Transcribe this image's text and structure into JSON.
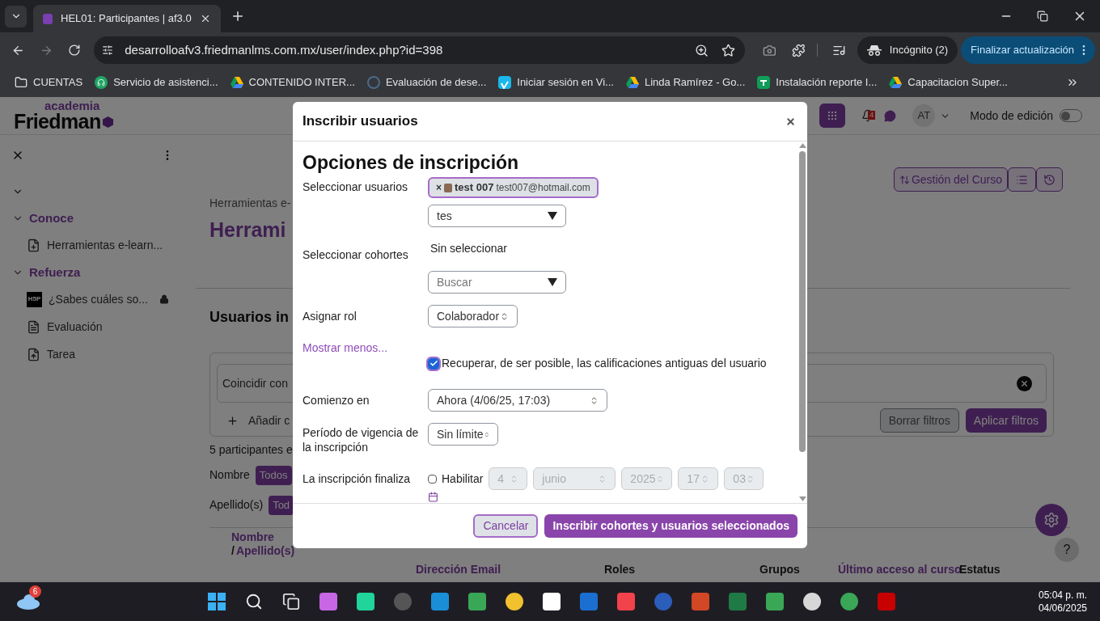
{
  "browser": {
    "tabs": [
      {
        "title": "HEL01: Participantes | af3.0",
        "selected": true
      }
    ],
    "url": "desarrolloafv3.friedmanlms.com.mx/user/index.php?id=398",
    "bookmarks": [
      {
        "label": "CUENTAS",
        "kind": "folder"
      },
      {
        "label": "Servicio de asistenci...",
        "kind": "headset"
      },
      {
        "label": "CONTENIDO INTER...",
        "kind": "drive"
      },
      {
        "label": "Evaluación de dese...",
        "kind": "af"
      },
      {
        "label": "Iniciar sesión en Vi...",
        "kind": "vimeo"
      },
      {
        "label": "Linda Ramírez - Go...",
        "kind": "drive"
      },
      {
        "label": "Instalación reporte I...",
        "kind": "sheet"
      },
      {
        "label": "Capacitacion Super...",
        "kind": "drive"
      }
    ],
    "incognito": "Incógnito (2)",
    "update_button": "Finalizar actualización"
  },
  "site": {
    "logo_top": "academia",
    "logo_main": "Friedman",
    "notifications": "4",
    "avatar": "AT",
    "edit_mode": {
      "label": "Modo de edición",
      "on": false
    }
  },
  "drawer": {
    "sections": [
      {
        "title": "Conoce",
        "expanded": true,
        "items": [
          {
            "label": "Herramientas e-learn...",
            "kind": "page",
            "locked": false
          }
        ]
      },
      {
        "title": "Refuerza",
        "expanded": true,
        "items": [
          {
            "label": "¿Sabes cuáles so...",
            "kind": "h5p",
            "logo_text": "H5P",
            "locked": true
          },
          {
            "label": "Evaluación",
            "kind": "quiz",
            "locked": false
          },
          {
            "label": "Tarea",
            "kind": "assign",
            "locked": false
          }
        ]
      }
    ]
  },
  "page": {
    "breadcrumb": "Herramientas e-",
    "title": "Herrami",
    "course_menu": "Gestión del Curso",
    "section_title": "Usuarios in",
    "filter": {
      "match_label": "Coincidir con",
      "add_label": "Añadir c",
      "clear": "Borrar filtros",
      "apply": "Aplicar filtros"
    },
    "count": "5 participantes e",
    "initials": [
      {
        "label": "Nombre",
        "button": "Todos"
      },
      {
        "label": "Apellido(s)",
        "button": "Tod"
      }
    ],
    "table": {
      "name_header": "Nombre",
      "name_separator": "/",
      "surname_header": "Apellido(s)",
      "columns": [
        {
          "label": "Dirección Email",
          "sortable": true
        },
        {
          "label": "Roles",
          "sortable": false
        },
        {
          "label": "Grupos",
          "sortable": false
        },
        {
          "label": "Último acceso al curso",
          "sortable": true
        },
        {
          "label": "Estatus",
          "sortable": false
        }
      ]
    },
    "help": "?"
  },
  "modal": {
    "title": "Inscribir usuarios",
    "heading": "Opciones de inscripción",
    "users": {
      "label": "Seleccionar usuarios",
      "chip": {
        "remove": "×",
        "name": "test 007",
        "email": "test007@hotmail.com"
      },
      "search_value": "tes"
    },
    "cohorts": {
      "label": "Seleccionar cohortes",
      "status": "Sin seleccionar",
      "placeholder": "Buscar"
    },
    "role": {
      "label": "Asignar rol",
      "value": "Colaborador"
    },
    "toggle_link": "Mostrar menos...",
    "recover": {
      "label": "Recuperar, de ser posible, las calificaciones antiguas del usuario",
      "checked": true
    },
    "start": {
      "label": "Comienzo en",
      "value": "Ahora (4/06/25, 17:03)"
    },
    "duration": {
      "label": "Período de vigencia de la inscripción",
      "value": "Sin límite"
    },
    "end": {
      "label": "La inscripción finaliza",
      "enable_label": "Habilitar",
      "enabled": false,
      "parts": [
        "4",
        "junio",
        "2025",
        "17",
        "03"
      ]
    },
    "cancel": "Cancelar",
    "submit": "Inscribir cohortes y usuarios seleccionados"
  },
  "taskbar": {
    "weather_badge": "6",
    "time": "05:04 p. m.",
    "date": "04/06/2025"
  }
}
